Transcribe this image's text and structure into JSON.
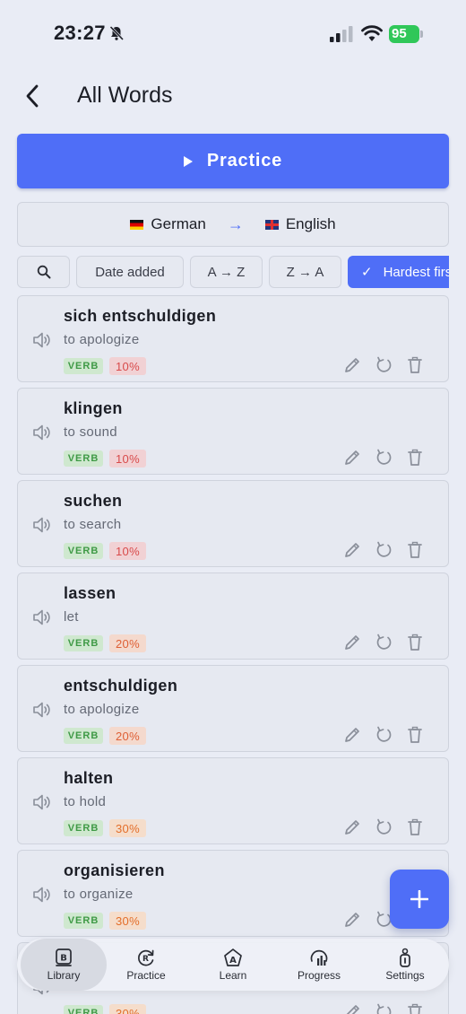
{
  "status_bar": {
    "time": "23:27",
    "battery": "95"
  },
  "header": {
    "title": "All Words"
  },
  "practice": {
    "label": "Practice"
  },
  "languages": {
    "source": "German",
    "target": "English"
  },
  "filters": [
    {
      "label": "Date added"
    },
    {
      "label": "A → Z"
    },
    {
      "label": "Z → A"
    },
    {
      "label": "Hardest first"
    }
  ],
  "words": [
    {
      "term": "sich entschuldigen",
      "translation": "to apologize",
      "type": "VERB",
      "score": "10%"
    },
    {
      "term": "klingen",
      "translation": "to sound",
      "type": "VERB",
      "score": "10%"
    },
    {
      "term": "suchen",
      "translation": "to search",
      "type": "VERB",
      "score": "10%"
    },
    {
      "term": "lassen",
      "translation": "let",
      "type": "VERB",
      "score": "20%"
    },
    {
      "term": "entschuldigen",
      "translation": "to apologize",
      "type": "VERB",
      "score": "20%"
    },
    {
      "term": "halten",
      "translation": "to hold",
      "type": "VERB",
      "score": "30%"
    },
    {
      "term": "organisieren",
      "translation": "to organize",
      "type": "VERB",
      "score": "30%"
    },
    {
      "term": "",
      "translation": "",
      "type": "VERB",
      "score": "30%"
    }
  ],
  "nav": [
    {
      "label": "Library"
    },
    {
      "label": "Practice"
    },
    {
      "label": "Learn"
    },
    {
      "label": "Progress"
    },
    {
      "label": "Settings"
    }
  ],
  "colors": {
    "accent": "#4f6ef7",
    "background": "#e9ecf5",
    "verb_badge": "#cfe8cf"
  }
}
